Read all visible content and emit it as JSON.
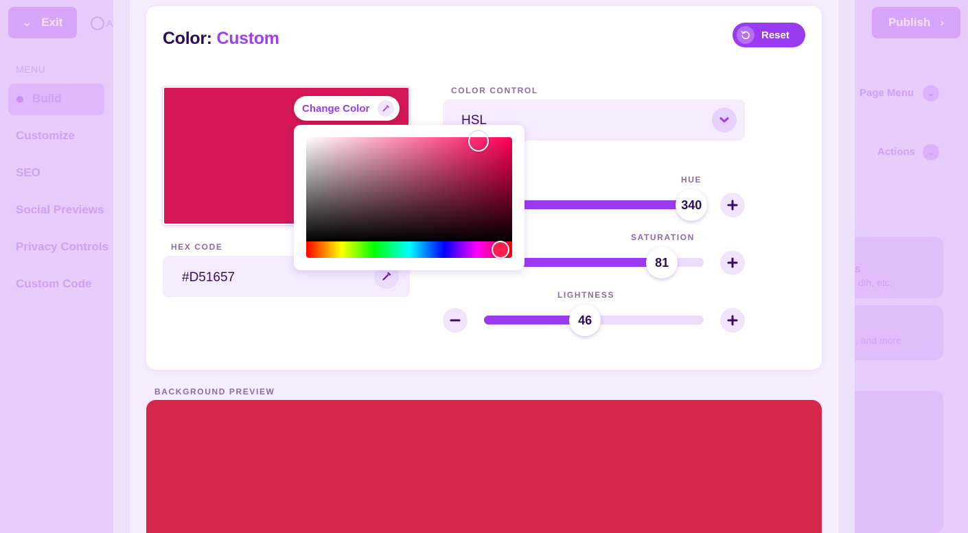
{
  "background": {
    "exit_label": "Exit",
    "autosave_label": "A",
    "publish_label": "Publish",
    "menu_label": "MENU",
    "nav": [
      "Build",
      "Customize",
      "SEO",
      "Social Previews",
      "Privacy Controls",
      "Custom Code"
    ],
    "page_menu_label": "Page Menu",
    "actions_label": "Actions",
    "card_snippet_1": "s",
    "card_snippet_1b": "dth, etc.",
    "card_snippet_2": ", and more"
  },
  "modal": {
    "title_prefix": "Color:",
    "title_value": "Custom",
    "reset_label": "Reset"
  },
  "swatch": {
    "color": "#D51657",
    "change_color_label": "Change Color"
  },
  "hex": {
    "label": "HEX CODE",
    "value": "#D51657"
  },
  "color_control": {
    "label": "COLOR CONTROL",
    "selected": "HSL"
  },
  "sliders": {
    "hue": {
      "label": "HUE",
      "value": 340,
      "max": 360,
      "display": "340"
    },
    "saturation": {
      "label": "SATURATION",
      "value": 81,
      "max": 100,
      "display": "81"
    },
    "lightness": {
      "label": "LIGHTNESS",
      "value": 46,
      "max": 100,
      "display": "46"
    }
  },
  "preview": {
    "label": "BACKGROUND PREVIEW",
    "color": "#D52749"
  },
  "colors": {
    "accent": "#9B3BEF",
    "title_dark": "#2D0A5A"
  }
}
